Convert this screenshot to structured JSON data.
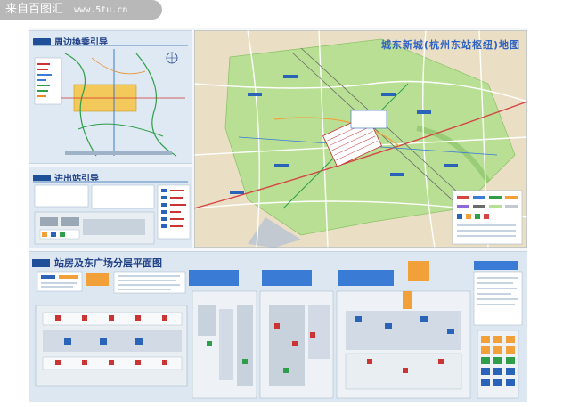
{
  "watermark": {
    "name": "来自百图汇",
    "site": "www.5tu.cn"
  },
  "panels": {
    "surrounding_transfer": {
      "title": "周边換乘引导"
    },
    "entry_exit": {
      "title": "进出站引导"
    },
    "hub_map": {
      "title": "城东新城(杭州东站枢纽)地图"
    },
    "floor_plan": {
      "title": "站房及东广场分层平面图"
    }
  },
  "colors": {
    "panel_bg": "#dfe9f3",
    "map_bg": "#eadfc4",
    "park_green": "#b9df94",
    "title_blue": "#1f3f86",
    "accent_orange": "#f2a03a",
    "accent_blue": "#2a64b9",
    "rail_red": "#d64545"
  }
}
